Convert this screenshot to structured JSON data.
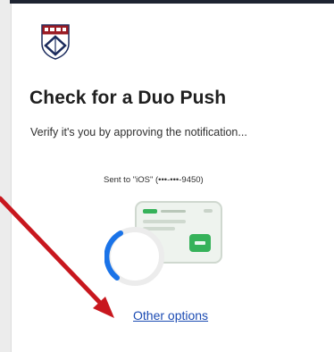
{
  "title": "Check for a Duo Push",
  "subtitle": "Verify it's you by approving the notification...",
  "sent_to": "Sent to \"iOS\" (•••-•••-9450)",
  "other_options_label": "Other options",
  "colors": {
    "accent": "#1b4bb3",
    "spinner": "#1a73e8",
    "arrow": "#c8171e",
    "brand_red": "#9b1b24",
    "brand_navy": "#1a2a5c"
  },
  "icons": [
    "university-shield-icon",
    "phone-notification-icon",
    "loading-spinner-icon",
    "annotation-arrow"
  ]
}
